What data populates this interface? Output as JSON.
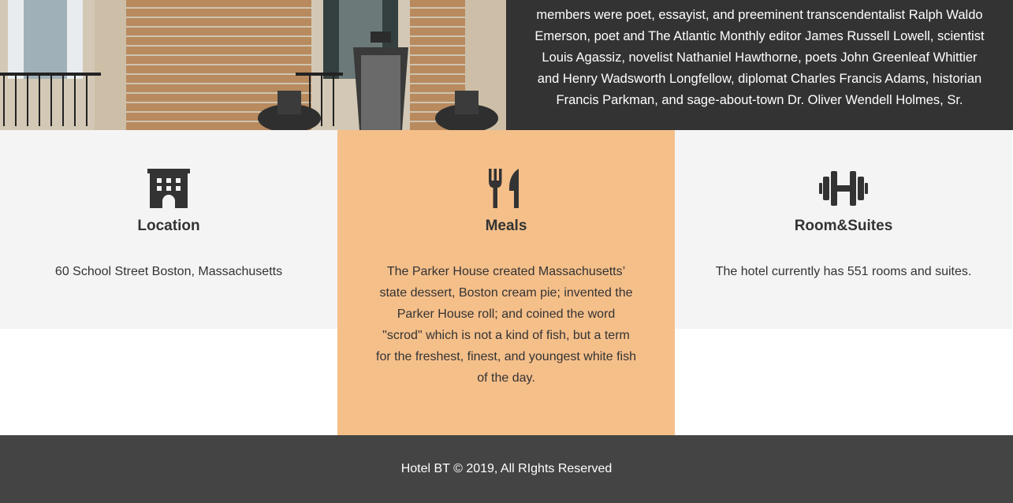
{
  "story": {
    "text": "members were poet, essayist, and preeminent transcendentalist Ralph Waldo Emerson, poet and The Atlantic Monthly editor James Russell Lowell, scientist Louis Agassiz, novelist Nathaniel Hawthorne, poets John Greenleaf Whittier and Henry Wadsworth Longfellow, diplomat Charles Francis Adams, historian Francis Parkman, and sage-about-town Dr. Oliver Wendell Holmes, Sr."
  },
  "features": [
    {
      "icon": "building-icon",
      "title": "Location",
      "text": "60 School Street Boston, Massachusetts"
    },
    {
      "icon": "utensils-icon",
      "title": "Meals",
      "text": "The Parker House created Massachusetts’ state dessert, Boston cream pie; invented the Parker House roll; and coined the word \"scrod\" which is not a kind of fish, but a term for the freshest, finest, and youngest white fish of the day."
    },
    {
      "icon": "dumbbell-icon",
      "title": "Room&Suites",
      "text": "The hotel currently has 551 rooms and suites."
    }
  ],
  "footer": {
    "text": "Hotel BT © 2019, All RIghts Reserved"
  },
  "colors": {
    "dark": "#333333",
    "accent": "#f5bf8a",
    "light": "#f4f4f4",
    "footer": "#444444"
  }
}
